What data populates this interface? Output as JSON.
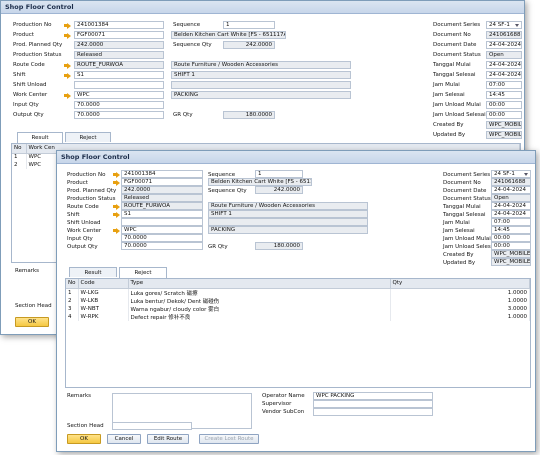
{
  "title": "Shop Floor Control",
  "back": {
    "labels": {
      "production_no": "Production No",
      "product": "Product",
      "prod_planned_qty": "Prod. Planned Qty",
      "production_status": "Production Status",
      "route_code": "Route Code",
      "shift": "Shift",
      "shift_unload": "Shift Unload",
      "work_center": "Work Center",
      "input_qty": "Input Qty",
      "output_qty": "Output Qty",
      "sequence": "Sequence",
      "sequence_qty": "Sequence Qty",
      "gr_qty": "GR Qty",
      "document_series": "Document Series",
      "document_no": "Document No",
      "document_date": "Document Date",
      "document_status": "Document Status",
      "tanggal_mulai": "Tanggal Mulai",
      "tanggal_selesai": "Tanggal Selesai",
      "jam_mulai": "Jam Mulai",
      "jam_selesai": "Jam Selesai",
      "jam_unload_mulai": "Jam Unload Mulai",
      "jam_unload_selesai": "Jam Unload Selesai",
      "created_by": "Created By",
      "updated_by": "Updated By"
    },
    "values": {
      "production_no": "241001384",
      "product": "FGF00071",
      "product_desc": "Belden Kitchen Cart White [FS - 651117AS]",
      "prod_planned_qty": "242.0000",
      "production_status": "Released",
      "route_code": "ROUTE_FURWOA",
      "route_desc": "Route Furniture / Wooden Accessories",
      "shift": "S1",
      "shift_desc": "SHIFT 1",
      "shift_unload": "",
      "work_center": "WPC",
      "work_center_desc": "PACKING",
      "input_qty": "70.0000",
      "output_qty": "70.0000",
      "sequence": "1",
      "sequence_qty": "242.0000",
      "gr_qty": "180.0000",
      "document_series": "24 SF-1",
      "document_no": "241061688",
      "document_date": "24-04-2024",
      "document_status": "Open",
      "tanggal_mulai": "24-04-2024",
      "tanggal_selesai": "24-04-2024",
      "jam_mulai": "07:00",
      "jam_selesai": "14:45",
      "jam_unload_mulai": "00:00",
      "jam_unload_selesai": "00:00",
      "created_by": "WPC_MOBILE1",
      "updated_by": "WPC_MOBILE1"
    },
    "tabs": [
      "Result",
      "Reject"
    ],
    "grid_headers": [
      "No",
      "Work Cen"
    ],
    "grid_rows": [
      [
        "1",
        "WPC"
      ],
      [
        "2",
        "WPC"
      ]
    ],
    "remarks_label": "Remarks",
    "section_head_label": "Section Head",
    "ok_label": "OK"
  },
  "front": {
    "labels": {
      "production_no": "Production No",
      "product": "Product",
      "prod_planned_qty": "Prod. Planned Qty",
      "production_status": "Production Status",
      "route_code": "Route Code",
      "shift": "Shift",
      "shift_unload": "Shift Unload",
      "work_center": "Work Center",
      "input_qty": "Input Qty",
      "output_qty": "Output Qty",
      "sequence": "Sequence",
      "sequence_qty": "Sequence Qty",
      "gr_qty": "GR Qty",
      "document_series": "Document Series",
      "document_no": "Document No",
      "document_date": "Document Date",
      "document_status": "Document Status",
      "tanggal_mulai": "Tanggal Mulai",
      "tanggal_selesai": "Tanggal Selesai",
      "jam_mulai": "Jam Mulai",
      "jam_selesai": "Jam Selesai",
      "jam_unload_mulai": "Jam Unload Mulai",
      "jam_unload_selesai": "Jam Unload Selesai",
      "created_by": "Created By",
      "updated_by": "Updated By",
      "remarks": "Remarks",
      "section_head": "Section Head",
      "operator_name": "Operator Name",
      "supervisor": "Supervisor",
      "vendor_subcon": "Vendor SubCon"
    },
    "values": {
      "production_no": "241001384",
      "product": "FGF00071",
      "product_desc": "Belden Kitchen Cart White [FS - 651117AS]",
      "prod_planned_qty": "242.0000",
      "production_status": "Released",
      "route_code": "ROUTE_FURWOA",
      "route_desc": "Route Furniture / Wooden Accessories",
      "shift": "S1",
      "shift_desc": "SHIFT 1",
      "shift_unload": "",
      "work_center": "WPC",
      "work_center_desc": "PACKING",
      "input_qty": "70.0000",
      "output_qty": "70.0000",
      "sequence": "1",
      "sequence_qty": "242.0000",
      "gr_qty": "180.0000",
      "document_series": "24 SF-1",
      "document_no": "241061688",
      "document_date": "24-04-2024",
      "document_status": "Open",
      "tanggal_mulai": "24-04-2024",
      "tanggal_selesai": "24-04-2024",
      "jam_mulai": "07:00",
      "jam_selesai": "14:45",
      "jam_unload_mulai": "00:00",
      "jam_unload_selesai": "00:00",
      "created_by": "WPC_MOBILE1",
      "updated_by": "WPC_MOBILE1",
      "operator_name": "WPC PACKING",
      "supervisor": "",
      "vendor_subcon": ""
    },
    "tabs": [
      "Result",
      "Reject"
    ],
    "active_tab": "Reject",
    "grid_headers": [
      "No",
      "Code",
      "Type",
      "Qty"
    ],
    "grid_rows": [
      {
        "no": "1",
        "code": "W-LKG",
        "type": "Luka gores/ Scratch 磁擦",
        "qty": "1.0000"
      },
      {
        "no": "2",
        "code": "W-LKB",
        "type": "Luka bentur/ Dekok/ Dent 磁碰伤",
        "qty": "1.0000"
      },
      {
        "no": "3",
        "code": "W-NBT",
        "type": "Warna ngabur/ cloudy color 雾白",
        "qty": "3.0000"
      },
      {
        "no": "4",
        "code": "W-RPK",
        "type": "Defect repair 修补不良",
        "qty": "1.0000"
      }
    ],
    "buttons": {
      "ok": "OK",
      "cancel": "Cancel",
      "edit_route": "Edit Route",
      "create_lost_route": "Create Lost Route"
    }
  },
  "colors": {
    "accent_arrow": "#e8a010",
    "primary_button": "#f5c842",
    "window_border": "#7f9db9"
  }
}
